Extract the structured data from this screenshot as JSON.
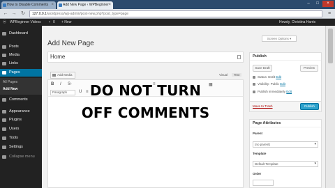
{
  "browser": {
    "tabs": [
      {
        "label": "How to Disable Comments"
      },
      {
        "label": "Add New Page ‹ WPBeginner"
      }
    ],
    "url_host": "127.0.0.1",
    "url_path": "/wordpress/wp-admin/post-new.php?post_type=page"
  },
  "adminbar": {
    "site_name": "WPBeginner Videos",
    "comments_count": "0",
    "new_label": "+ New",
    "user_greeting": "Howdy, Christina Harris"
  },
  "sidebar": {
    "items": [
      {
        "label": "Dashboard"
      },
      {
        "label": "Posts"
      },
      {
        "label": "Media"
      },
      {
        "label": "Links"
      },
      {
        "label": "Pages"
      },
      {
        "label": "Comments"
      },
      {
        "label": "Appearance"
      },
      {
        "label": "Plugins"
      },
      {
        "label": "Users"
      },
      {
        "label": "Tools"
      },
      {
        "label": "Settings"
      },
      {
        "label": "Collapse menu"
      }
    ],
    "submenu": [
      {
        "label": "All Pages"
      },
      {
        "label": "Add New"
      }
    ]
  },
  "page": {
    "title": "Add New Page",
    "screen_options": "Screen Options ▾",
    "title_value": "Home"
  },
  "editor": {
    "add_media": "Add Media",
    "tab_visual": "Visual",
    "tab_text": "Text",
    "format_select": "Paragraph",
    "bold": "B",
    "italic": "I"
  },
  "overlay": {
    "line1": "DO NOT TURN",
    "line2": "OFF COMMENTS"
  },
  "publish": {
    "heading": "Publish",
    "save_draft": "Save Draft",
    "preview": "Preview",
    "status_label": "Status: Draft",
    "visibility_label": "Visibility: Public",
    "schedule_label": "Publish immediately",
    "edit_link": "Edit",
    "trash": "Move to Trash",
    "publish_button": "Publish"
  },
  "attributes": {
    "heading": "Page Attributes",
    "parent_label": "Parent",
    "parent_value": "(no parent)",
    "template_label": "Template",
    "template_value": "Default Template",
    "order_label": "Order"
  },
  "colors": {
    "admin_bar": "#222222",
    "sidebar_active": "#0074a2",
    "publish_button": "#2ea2cc",
    "overlay_text": "#000000"
  }
}
